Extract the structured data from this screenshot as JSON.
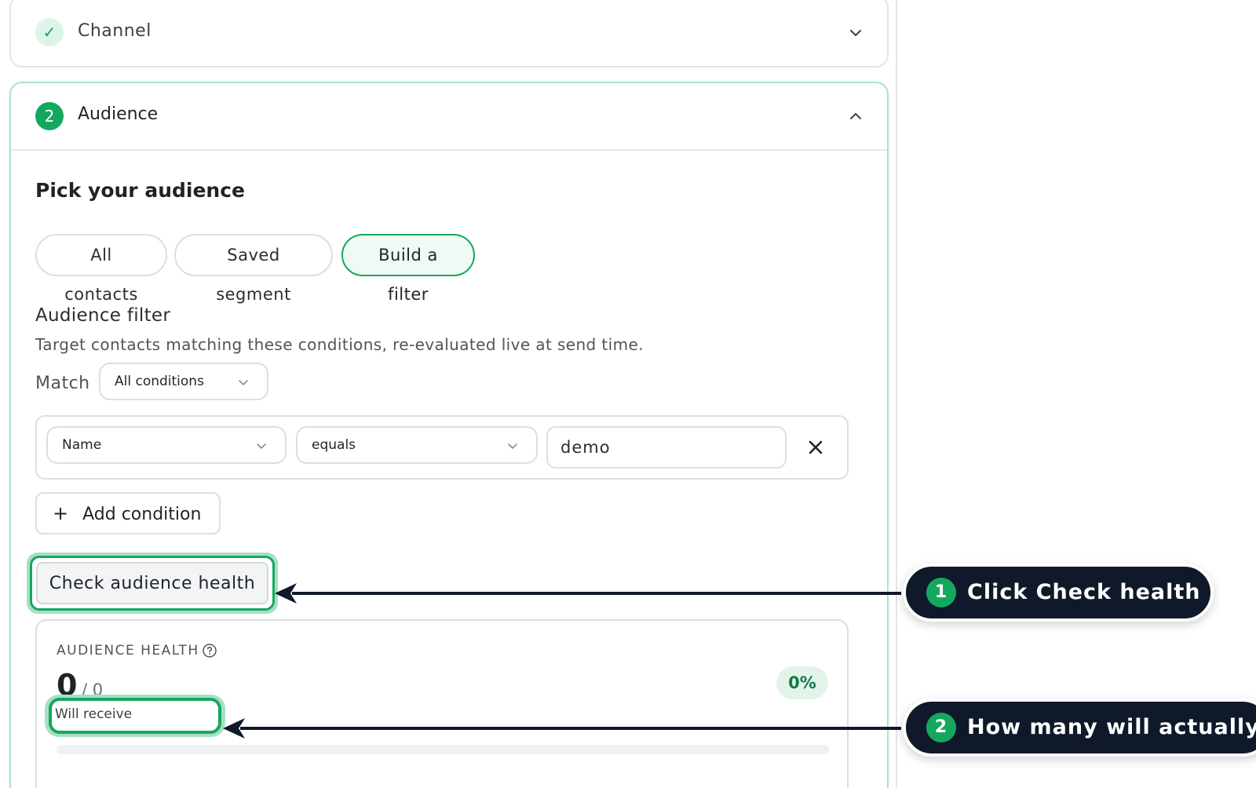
{
  "channel": {
    "title": "Channel"
  },
  "audience": {
    "step": "2",
    "title": "Audience",
    "section_title": "Pick your audience",
    "options": [
      "All contacts",
      "Saved segment",
      "Build a filter"
    ],
    "selected_option": "Build a filter",
    "filter": {
      "title": "Audience filter",
      "subtitle": "Target contacts matching these conditions, re-evaluated live at send time.",
      "match_label": "Match",
      "match_value": "All conditions",
      "condition": {
        "field": "Name",
        "operator": "equals",
        "value": "demo"
      },
      "add_label": "Add condition"
    },
    "health_button": "Check audience health",
    "health": {
      "label": "AUDIENCE HEALTH",
      "count": "0",
      "total": "/ 0",
      "percent": "0%",
      "will_receive": "Will receive",
      "progress": 0
    }
  },
  "callouts": [
    {
      "num": "1",
      "text": "Click Check health"
    },
    {
      "num": "2",
      "text": "How many will actually r"
    }
  ],
  "colors": {
    "accent": "#14a85f",
    "callout_bg": "#0f1929",
    "badge_bg": "#e2f3ea"
  }
}
